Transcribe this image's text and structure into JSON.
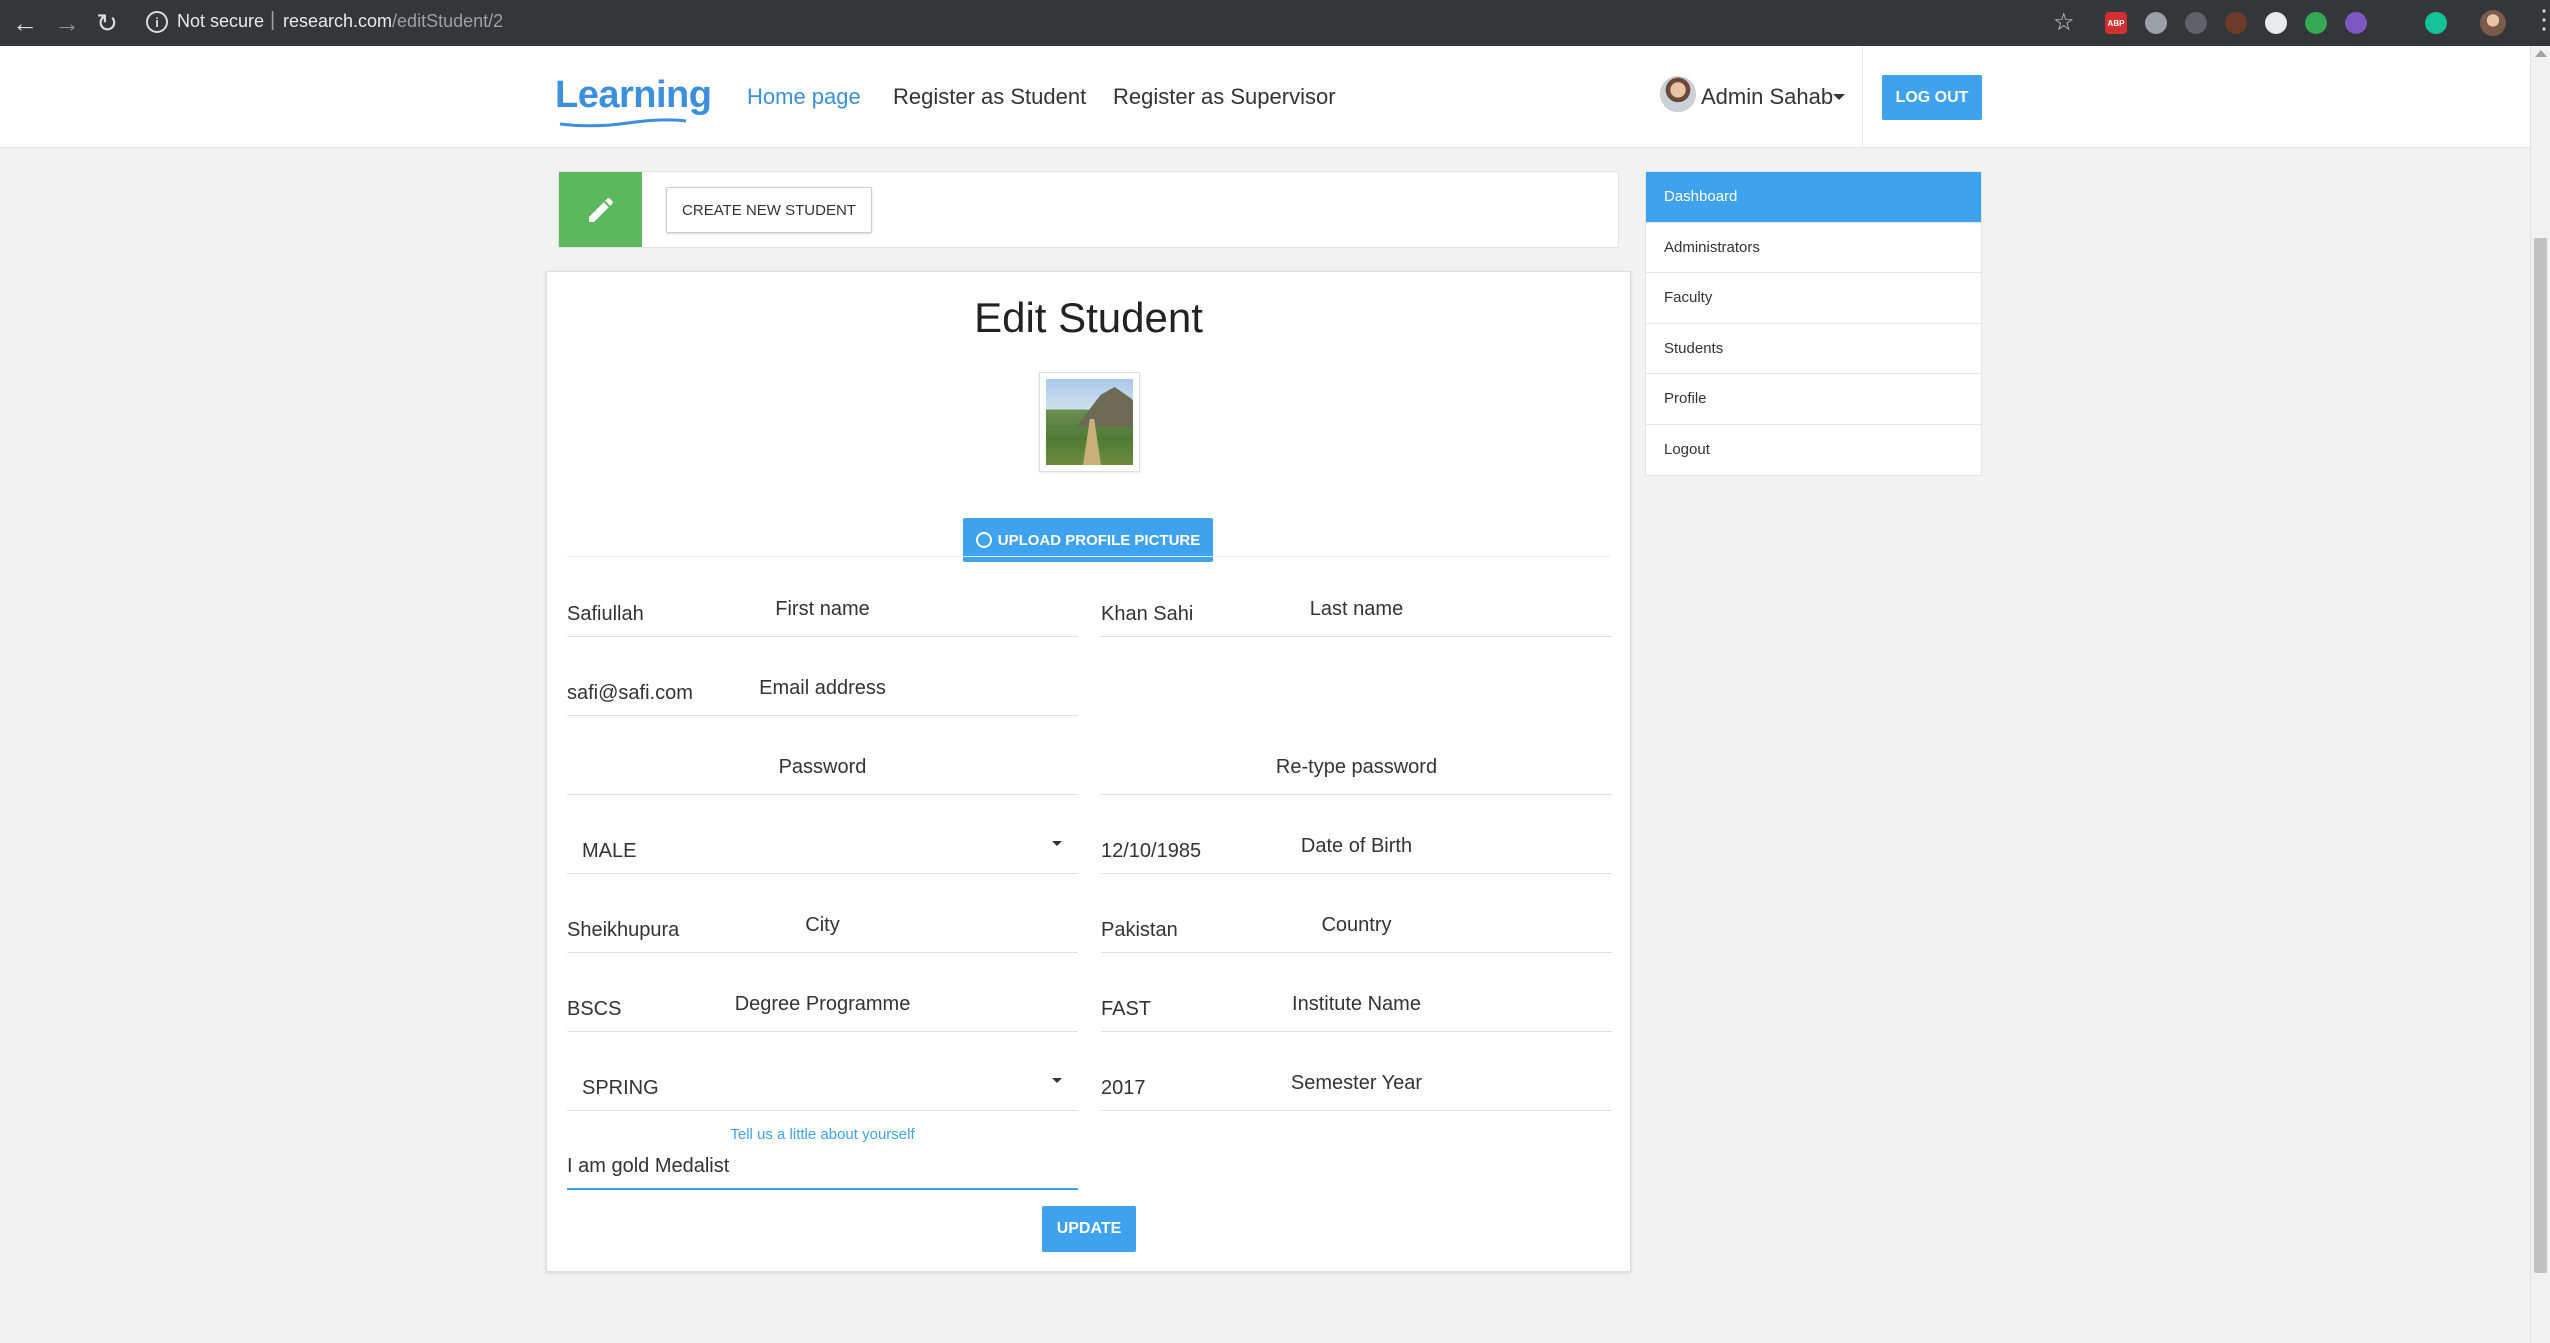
{
  "browser": {
    "security_label": "Not secure",
    "url_host": "research.com",
    "url_path": "/editStudent/2"
  },
  "navbar": {
    "logo": "Learning",
    "links": [
      "Home page",
      "Register as Student",
      "Register as Supervisor"
    ],
    "user_name": "Admin Sahab",
    "logout_label": "LOG OUT"
  },
  "toolbar": {
    "create_label": "CREATE NEW STUDENT"
  },
  "form": {
    "title": "Edit Student",
    "upload_label": "UPLOAD PROFILE PICTURE",
    "first_name": {
      "value": "Safiullah",
      "label": "First name"
    },
    "last_name": {
      "value": "Khan Sahi",
      "label": "Last name"
    },
    "email": {
      "value": "safi@safi.com",
      "label": "Email address"
    },
    "password": {
      "value": "",
      "label": "Password"
    },
    "retype_password": {
      "value": "",
      "label": "Re-type password"
    },
    "gender": {
      "value": "MALE"
    },
    "dob": {
      "value": "12/10/1985",
      "label": "Date of Birth"
    },
    "city": {
      "value": "Sheikhupura",
      "label": "City"
    },
    "country": {
      "value": "Pakistan",
      "label": "Country"
    },
    "degree": {
      "value": "BSCS",
      "label": "Degree Programme"
    },
    "institute": {
      "value": "FAST",
      "label": "Institute Name"
    },
    "semester": {
      "value": "SPRING"
    },
    "semester_year": {
      "value": "2017",
      "label": "Semester Year"
    },
    "about": {
      "value": "I am gold Medalist",
      "label": "Tell us a little about yourself"
    },
    "update_label": "UPDATE"
  },
  "sidebar": {
    "items": [
      "Dashboard",
      "Administrators",
      "Faculty",
      "Students",
      "Profile",
      "Logout"
    ]
  },
  "colors": {
    "primary": "#3fa2ef",
    "success": "#5cb85c",
    "chrome": "#35363a"
  }
}
